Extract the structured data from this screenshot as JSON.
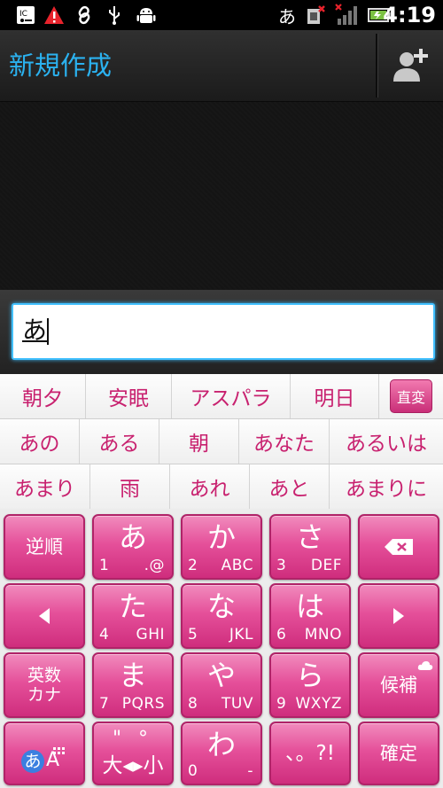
{
  "status_bar": {
    "icons": [
      "usb-debug-icon",
      "warning-icon",
      "link-icon",
      "usb-icon",
      "android-icon"
    ],
    "ime_indicator": "あ",
    "time": "4:19"
  },
  "title_bar": {
    "title": "新規作成",
    "add_contact_icon": "add-contact-icon"
  },
  "compose": {
    "input_value": "あ"
  },
  "candidates": {
    "row1": [
      "朝夕",
      "安眠",
      "アスパラ",
      "明日"
    ],
    "henkan_label": "直変",
    "row2": [
      "あの",
      "ある",
      "朝",
      "あなた",
      "あるいは"
    ],
    "row3": [
      "あまり",
      "雨",
      "あれ",
      "あと",
      "あまりに"
    ]
  },
  "keyboard": {
    "reverse": "逆順",
    "a": {
      "main": "あ",
      "num": "1",
      "sub": ".@"
    },
    "ka": {
      "main": "か",
      "num": "2",
      "sub": "ABC"
    },
    "sa": {
      "main": "さ",
      "num": "3",
      "sub": "DEF"
    },
    "ta": {
      "main": "た",
      "num": "4",
      "sub": "GHI"
    },
    "na": {
      "main": "な",
      "num": "5",
      "sub": "JKL"
    },
    "ha": {
      "main": "は",
      "num": "6",
      "sub": "MNO"
    },
    "ma": {
      "main": "ま",
      "num": "7",
      "sub": "PQRS"
    },
    "ya": {
      "main": "や",
      "num": "8",
      "sub": "TUV"
    },
    "ra": {
      "main": "ら",
      "num": "9",
      "sub": "WXYZ"
    },
    "wa": {
      "main": "わ",
      "num": "0",
      "sub": "-"
    },
    "eisu_line1": "英数",
    "eisu_line2": "カナ",
    "mode_a": "あ",
    "mode_b": "A",
    "dakuten_top": "\" °",
    "dakuten_bottom": "大◂▸小",
    "punct": "、。?!",
    "candidates_key": "候補",
    "confirm": "確定",
    "accent_color": "#e14a95"
  }
}
